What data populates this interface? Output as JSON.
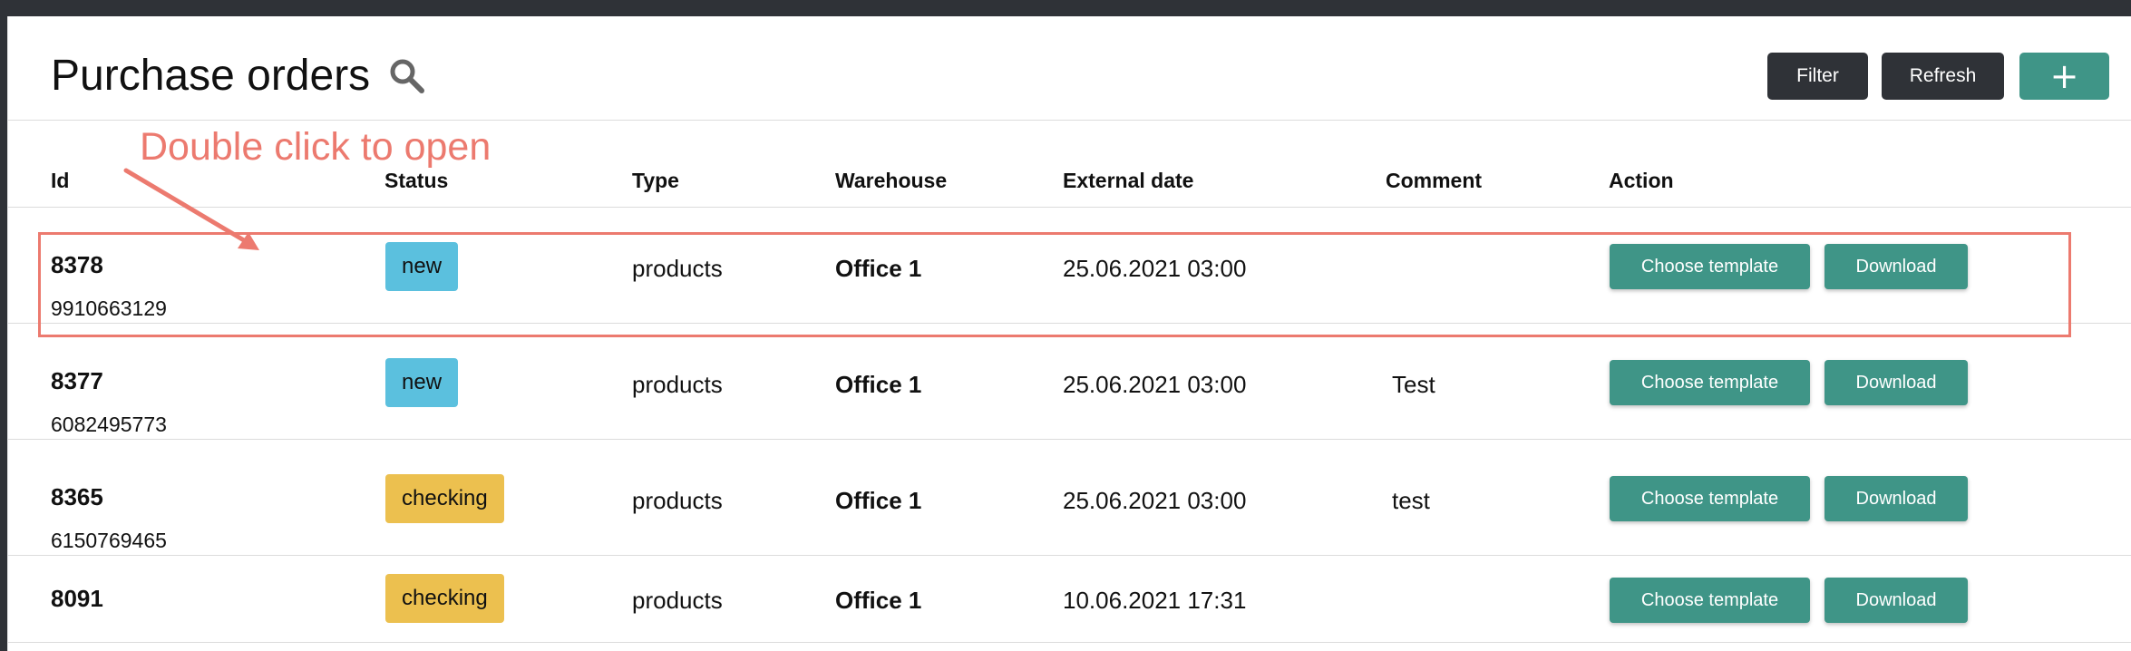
{
  "header": {
    "title": "Purchase orders",
    "buttons": {
      "filter": "Filter",
      "refresh": "Refresh",
      "add": "+"
    }
  },
  "columns": [
    "Id",
    "Status",
    "Type",
    "Warehouse",
    "External date",
    "Comment",
    "Action"
  ],
  "rows": [
    {
      "id": "8378",
      "sub_id": "9910663129",
      "status": "new",
      "type": "products",
      "warehouse": "Office 1",
      "date": "25.06.2021 03:00",
      "comment": "",
      "actions": [
        "Choose template",
        "Download"
      ]
    },
    {
      "id": "8377",
      "sub_id": "6082495773",
      "status": "new",
      "type": "products",
      "warehouse": "Office 1",
      "date": "25.06.2021 03:00",
      "comment": "Test",
      "actions": [
        "Choose template",
        "Download"
      ]
    },
    {
      "id": "8365",
      "sub_id": "6150769465",
      "status": "checking",
      "type": "products",
      "warehouse": "Office 1",
      "date": "25.06.2021 03:00",
      "comment": "test",
      "actions": [
        "Choose template",
        "Download"
      ]
    },
    {
      "id": "8091",
      "sub_id": "",
      "status": "checking",
      "type": "products",
      "warehouse": "Office 1",
      "date": "10.06.2021 17:31",
      "comment": "",
      "actions": [
        "Choose template",
        "Download"
      ]
    }
  ],
  "annotation": {
    "text": "Double click to open",
    "color": "#ec7a6f"
  },
  "colors": {
    "accent": "#3f9587",
    "dark": "#2f3237",
    "status_new": "#5bc0de",
    "status_checking": "#ecc04f"
  }
}
